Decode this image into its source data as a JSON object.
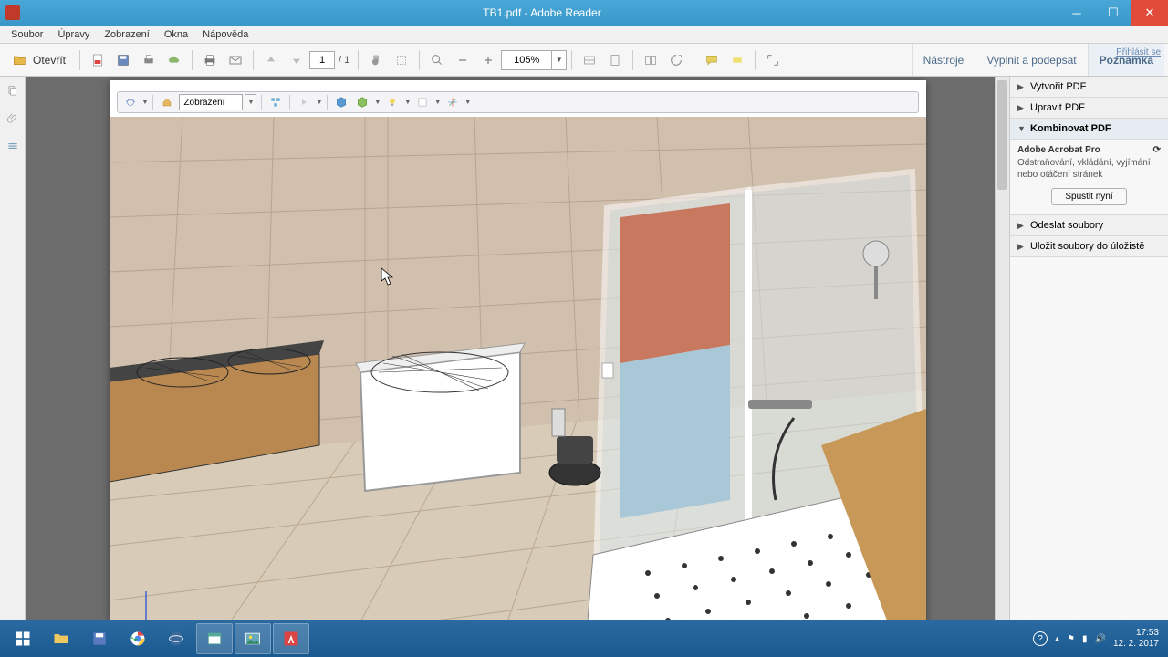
{
  "app": {
    "title": "TB1.pdf - Adobe Reader"
  },
  "menu": {
    "items": [
      "Soubor",
      "Úpravy",
      "Zobrazení",
      "Okna",
      "Nápověda"
    ]
  },
  "toolbar": {
    "open_label": "Otevřít",
    "page_current": "1",
    "page_total": "/ 1",
    "zoom_value": "105%",
    "right": {
      "tools": "Nástroje",
      "sign": "Vyplnit a podepsat",
      "comment": "Poznámka"
    },
    "signin": "Přihlásit se"
  },
  "viewer": {
    "view_label": "Zobrazení"
  },
  "right_panel": {
    "items": [
      {
        "label": "Vytvořit PDF",
        "expanded": false
      },
      {
        "label": "Upravit PDF",
        "expanded": false
      },
      {
        "label": "Kombinovat PDF",
        "expanded": true,
        "product": "Adobe Acrobat Pro",
        "desc": "Odstraňování, vkládání, vyjímání nebo otáčení stránek",
        "button": "Spustit nyní"
      },
      {
        "label": "Odeslat soubory",
        "expanded": false
      },
      {
        "label": "Uložit soubory do úložistě",
        "expanded": false
      }
    ]
  },
  "tray": {
    "time": "17:53",
    "date": "12. 2. 2017"
  }
}
